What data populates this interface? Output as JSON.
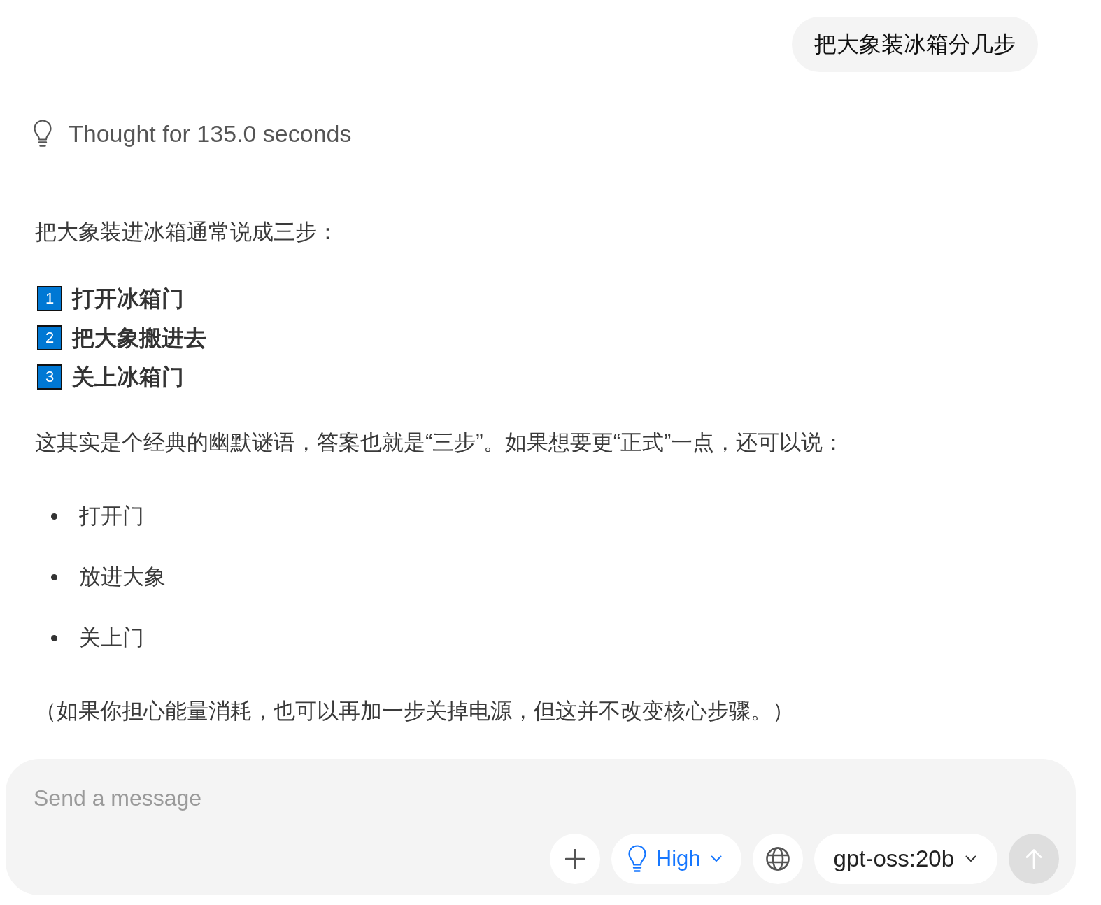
{
  "user_message": {
    "text": "把大象装冰箱分几步"
  },
  "thinking": {
    "label": "Thought for 135.0 seconds"
  },
  "answer": {
    "intro": "把大象装进冰箱通常说成三步：",
    "steps": [
      {
        "number": "1",
        "text": "打开冰箱门"
      },
      {
        "number": "2",
        "text": "把大象搬进去"
      },
      {
        "number": "3",
        "text": "关上冰箱门"
      }
    ],
    "paragraph": "这其实是个经典的幽默谜语，答案也就是“三步”。如果想要更“正式”一点，还可以说：",
    "bullets": [
      "打开门",
      "放进大象",
      "关上门"
    ],
    "note": "（如果你担心能量消耗，也可以再加一步关掉电源，但这并不改变核心步骤。）"
  },
  "composer": {
    "placeholder": "Send a message",
    "reasoning_effort": "High",
    "model": "gpt-oss:20b",
    "send_disabled": true
  }
}
